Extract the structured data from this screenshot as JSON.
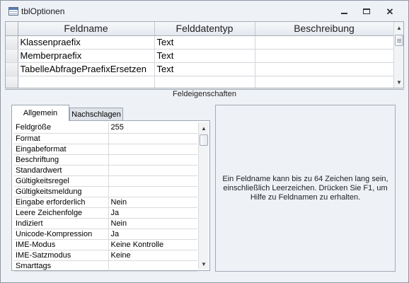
{
  "window": {
    "title": "tblOptionen",
    "icon": "table-icon"
  },
  "grid": {
    "columns": [
      "Feldname",
      "Felddatentyp",
      "Beschreibung"
    ],
    "rows": [
      {
        "name": "Klassenpraefix",
        "type": "Text",
        "description": ""
      },
      {
        "name": "Memberpraefix",
        "type": "Text",
        "description": ""
      },
      {
        "name": "TabelleAbfragePraefixErsetzen",
        "type": "Text",
        "description": ""
      },
      {
        "name": "",
        "type": "",
        "description": ""
      }
    ]
  },
  "section": {
    "title": "Feldeigenschaften"
  },
  "tabs": [
    {
      "label": "Allgemein",
      "active": true
    },
    {
      "label": "Nachschlagen",
      "active": false
    }
  ],
  "properties": [
    {
      "label": "Feldgröße",
      "value": "255"
    },
    {
      "label": "Format",
      "value": ""
    },
    {
      "label": "Eingabeformat",
      "value": ""
    },
    {
      "label": "Beschriftung",
      "value": ""
    },
    {
      "label": "Standardwert",
      "value": ""
    },
    {
      "label": "Gültigkeitsregel",
      "value": ""
    },
    {
      "label": "Gültigkeitsmeldung",
      "value": ""
    },
    {
      "label": "Eingabe erforderlich",
      "value": "Nein"
    },
    {
      "label": "Leere Zeichenfolge",
      "value": "Ja"
    },
    {
      "label": "Indiziert",
      "value": "Nein"
    },
    {
      "label": "Unicode-Kompression",
      "value": "Ja"
    },
    {
      "label": "IME-Modus",
      "value": "Keine Kontrolle"
    },
    {
      "label": "IME-Satzmodus",
      "value": "Keine"
    },
    {
      "label": "Smarttags",
      "value": ""
    }
  ],
  "help": {
    "text": "Ein Feldname kann bis zu 64 Zeichen lang sein, einschließlich Leerzeichen. Drücken Sie F1, um Hilfe zu Feldnamen zu erhalten."
  },
  "colors": {
    "window_bg": "#eef1f6",
    "border": "#8d97a5",
    "header_bg": "#e4e8ef"
  }
}
